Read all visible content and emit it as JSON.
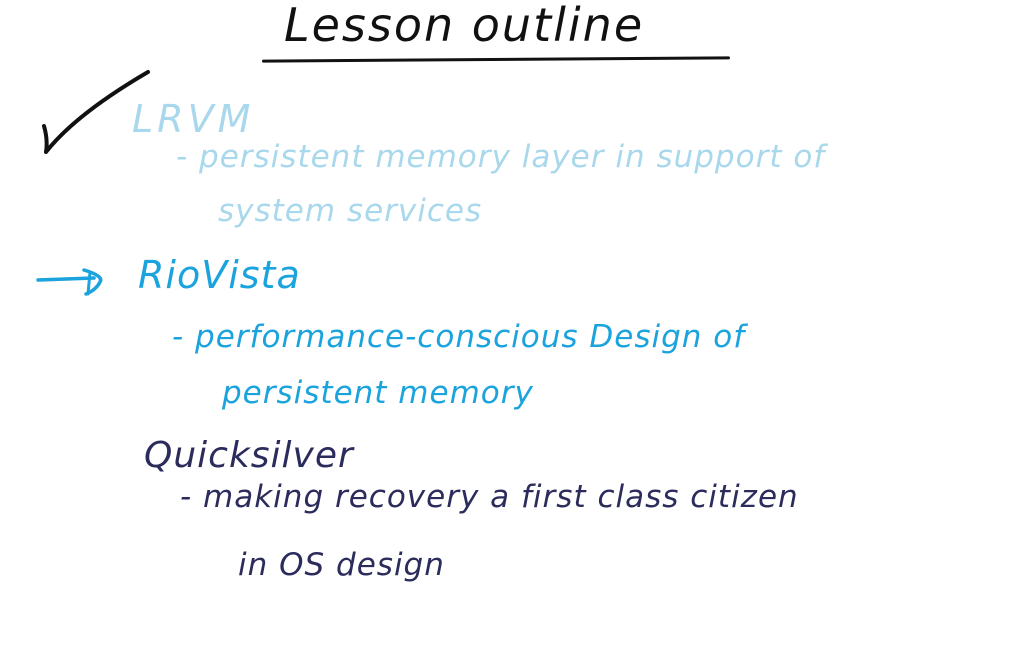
{
  "title": "Lesson outline",
  "sections": [
    {
      "heading": "LRVM",
      "lines": [
        "- persistent memory layer in support of",
        "system services"
      ],
      "color": "#a9d8ec",
      "marker": "checkmark-icon"
    },
    {
      "heading": "RioVista",
      "lines": [
        "- performance-conscious Design of",
        "persistent memory"
      ],
      "color": "#1aa3dc",
      "marker": "arrow-right-icon"
    },
    {
      "heading": "Quicksilver",
      "lines": [
        "- making recovery a first class citizen",
        "in OS design"
      ],
      "color": "#2b2c5c"
    }
  ],
  "title_color": "#111111"
}
